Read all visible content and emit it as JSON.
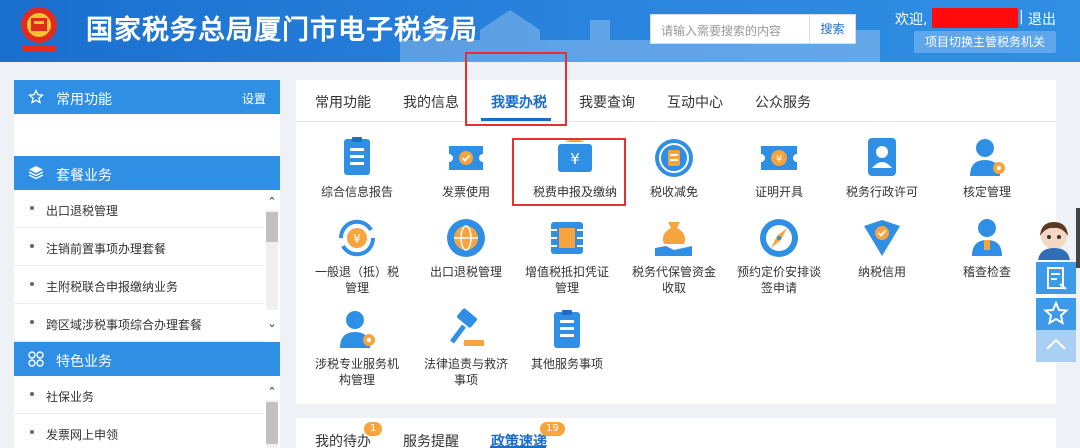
{
  "header": {
    "title": "国家税务总局厦门市电子税务局",
    "search_placeholder": "请输入需要搜索的内容",
    "search_button": "搜索",
    "welcome": "欢迎,",
    "separator": "|",
    "logout": "退出",
    "switch_button": "项目切换主管税务机关"
  },
  "sidebar": {
    "sections": [
      {
        "title": "常用功能",
        "action": "设置",
        "icon": "star-icon"
      },
      {
        "title": "套餐业务",
        "icon": "package-icon"
      },
      {
        "title": "特色业务",
        "icon": "grid-icon"
      }
    ],
    "package_items": [
      "出口退税管理",
      "注销前置事项办理套餐",
      "主附税联合申报缴纳业务",
      "跨区域涉税事项综合办理套餐"
    ],
    "special_items": [
      "社保业务",
      "发票网上申领"
    ]
  },
  "tabs": [
    "常用功能",
    "我的信息",
    "我要办税",
    "我要查询",
    "互动中心",
    "公众服务"
  ],
  "active_tab": "我要办税",
  "tiles": [
    {
      "label": "综合信息报告",
      "icon": "document-list-icon"
    },
    {
      "label": "发票使用",
      "icon": "invoice-ticket-icon"
    },
    {
      "label": "税费申报及缴纳",
      "icon": "yuan-wallet-icon"
    },
    {
      "label": "税收减免",
      "icon": "coin-stack-icon"
    },
    {
      "label": "证明开具",
      "icon": "yuan-ticket-icon"
    },
    {
      "label": "税务行政许可",
      "icon": "id-badge-icon"
    },
    {
      "label": "核定管理",
      "icon": "user-gear-icon"
    },
    {
      "label": "一般退（抵）税",
      "label2": "管理",
      "icon": "yuan-refresh-icon"
    },
    {
      "label": "出口退税管理",
      "icon": "globe-icon"
    },
    {
      "label": "增值税抵扣凭证",
      "label2": "管理",
      "icon": "voucher-icon"
    },
    {
      "label": "税务代保管资金",
      "label2": "收取",
      "icon": "money-bag-hand-icon"
    },
    {
      "label": "预约定价安排谈",
      "label2": "签申请",
      "icon": "compass-icon"
    },
    {
      "label": "纳税信用",
      "icon": "shield-check-icon"
    },
    {
      "label": "稽查检查",
      "icon": "user-icon"
    },
    {
      "label": "涉税专业服务机",
      "label2": "构管理",
      "icon": "user-gear-icon"
    },
    {
      "label": "法律追责与救济",
      "label2": "事项",
      "icon": "gavel-icon"
    },
    {
      "label": "其他服务事项",
      "icon": "clipboard-icon"
    }
  ],
  "bottom_tabs": [
    {
      "label": "我的待办",
      "badge": "1"
    },
    {
      "label": "服务提醒",
      "badge": ""
    },
    {
      "label": "政策速递",
      "badge": "19"
    }
  ],
  "colors": {
    "brand": "#1c6cc6",
    "header": "#2a84de",
    "highlight": "#e53030",
    "badge": "#f7a33e"
  }
}
